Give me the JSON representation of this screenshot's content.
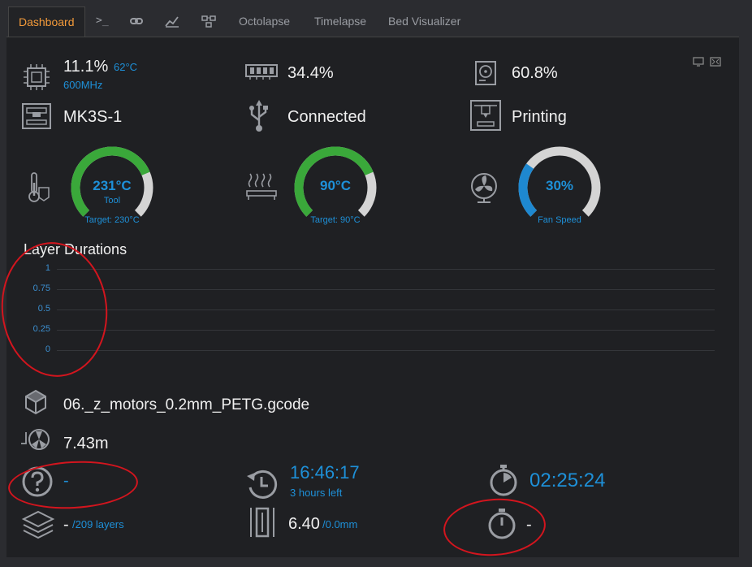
{
  "tabs": [
    {
      "label": "Dashboard",
      "active": true
    },
    {
      "label": ">_",
      "icon": "terminal-icon"
    },
    {
      "label": "",
      "icon": "link-icon"
    },
    {
      "label": "",
      "icon": "chart-icon"
    },
    {
      "label": "",
      "icon": "nodes-icon"
    },
    {
      "label": "Octolapse"
    },
    {
      "label": "Timelapse"
    },
    {
      "label": "Bed Visualizer"
    }
  ],
  "system": {
    "cpu_percent": "11.1%",
    "cpu_temp": "62°C",
    "cpu_freq": "600MHz",
    "memory_percent": "34.4%",
    "disk_percent": "60.8%"
  },
  "printer": {
    "name": "MK3S-1",
    "connection": "Connected",
    "state": "Printing"
  },
  "gauges": [
    {
      "value": "231°C",
      "label": "Tool",
      "target": "Target: 230°C",
      "fraction": 0.75,
      "color": "#3aa83a"
    },
    {
      "value": "90°C",
      "label": "",
      "target": "Target: 90°C",
      "fraction": 0.75,
      "color": "#3aa83a"
    },
    {
      "value": "30%",
      "label": "Fan Speed",
      "target": "",
      "fraction": 0.3,
      "color": "#1e88d0"
    }
  ],
  "chart_data": {
    "type": "line",
    "title": "Layer Durations",
    "y_ticks": [
      "1",
      "0.75",
      "0.5",
      "0.25",
      "0"
    ],
    "ylim": [
      0,
      1
    ],
    "series": []
  },
  "job": {
    "file": "06._z_motors_0.2mm_PETG.gcode",
    "filament": "7.43m",
    "estimate": "-",
    "eta_time": "16:46:17",
    "eta_left": "3 hours left",
    "elapsed": "02:25:24",
    "layer_current": "-",
    "layer_total": "/209 layers",
    "z_height": "6.40",
    "z_max": "/0.0mm",
    "layer_timer": "-"
  },
  "colors": {
    "accent": "#f39a3a",
    "value_blue": "#1e90d8",
    "gauge_green": "#3aa83a",
    "annotation_red": "#d3151e"
  }
}
